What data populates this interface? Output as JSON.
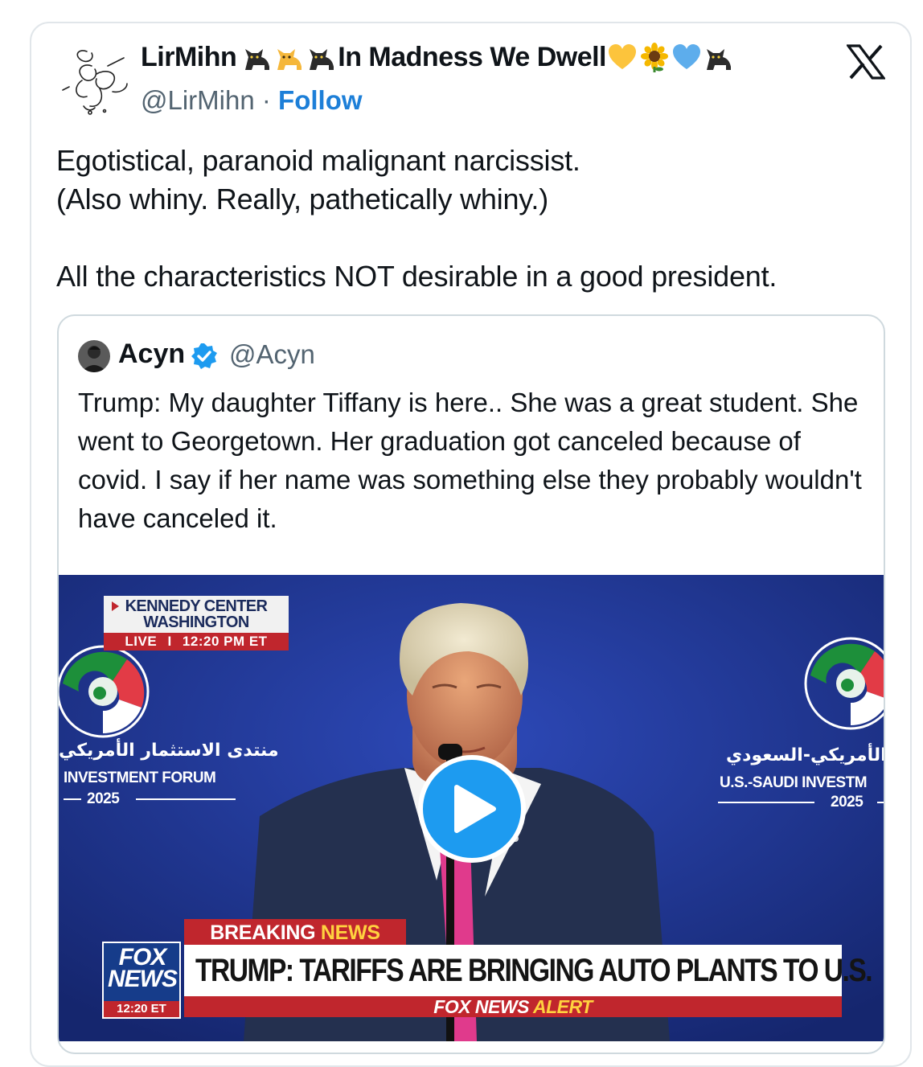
{
  "tweet": {
    "author_name": "LirMihn",
    "author_name_suffix": "In Madness We Dwell",
    "name_emojis_before": [
      "black-cat-icon",
      "cat-icon",
      "black-cat-icon"
    ],
    "name_emojis_after": [
      "yellow-heart-icon",
      "sunflower-icon",
      "blue-heart-icon",
      "black-cat-icon"
    ],
    "handle": "@LirMihn",
    "separator": "·",
    "follow_label": "Follow",
    "platform_icon": "x-logo-icon",
    "text": "Egotistical, paranoid malignant narcissist.\n(Also whiny. Really, pathetically whiny.)\n\nAll the characteristics NOT desirable in a good president."
  },
  "quoted_tweet": {
    "author_name": "Acyn",
    "verified_icon": "verified-badge-icon",
    "handle": "@Acyn",
    "text": "Trump: My daughter Tiffany is here.. She was a great student. She went to Georgetown. Her graduation got canceled because of covid. I say if her name was something else they probably wouldn't have canceled it."
  },
  "video": {
    "play_icon": "play-icon",
    "location_line1": "KENNEDY CENTER",
    "location_line2": "WASHINGTON",
    "live_label": "LIVE",
    "live_divider": "I",
    "live_time": "12:20 PM ET",
    "backdrop_left_arabic": "منتدى الاستثمار الأمريكي",
    "backdrop_left_title": "INVESTMENT FORUM",
    "backdrop_left_year": "2025",
    "backdrop_right_arabic": "ار الأمريكي-السعودي",
    "backdrop_right_title": "U.S.-SAUDI INVESTM",
    "backdrop_right_year": "2025",
    "breaking_label_1": "BREAKING",
    "breaking_label_2": "NEWS",
    "headline": "TRUMP: TARIFFS ARE BRINGING AUTO PLANTS TO U.S.",
    "network_line1": "FOX",
    "network_line2": "NEWS",
    "network_time": "12:20 ET",
    "alert_label_1": "FOX NEWS",
    "alert_label_2": "ALERT"
  }
}
